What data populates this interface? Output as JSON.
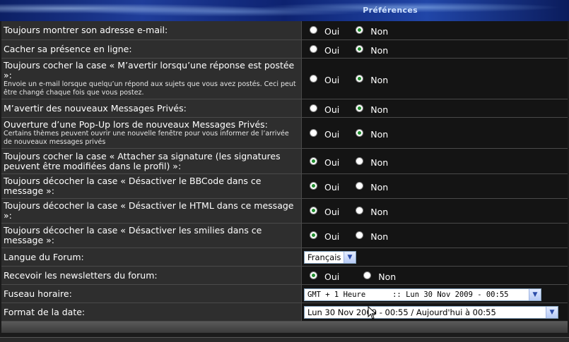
{
  "header": {
    "title": "Préférences"
  },
  "radio_labels": {
    "yes": "Oui",
    "no": "Non"
  },
  "rows": [
    {
      "label": "Toujours montrer son adresse e-mail:",
      "selected": "Non"
    },
    {
      "label": "Cacher sa présence en ligne:",
      "selected": "Non"
    },
    {
      "label": "Toujours cocher la case « M’avertir lorsqu’une réponse est postée »:",
      "note": "Envoie un e-mail lorsque quelqu’un répond aux sujets que vous avez postés. Ceci peut être changé chaque fois que vous postez.",
      "selected": "Non"
    },
    {
      "label": "M’avertir des nouveaux Messages Privés:",
      "selected": "Non"
    },
    {
      "label": "Ouverture d’une Pop-Up lors de nouveaux Messages Privés:",
      "note": "Certains thèmes peuvent ouvrir une nouvelle fenêtre pour vous informer de l’arrivée de nouveaux messages privés",
      "selected": "Non"
    },
    {
      "label": "Toujours cocher la case « Attacher sa signature (les signatures peuvent être modifiées dans le profil) »:",
      "selected": "Oui"
    },
    {
      "label": "Toujours décocher la case « Désactiver le BBCode dans ce message »:",
      "selected": "Oui"
    },
    {
      "label": "Toujours décocher la case « Désactiver le HTML dans ce message »:",
      "selected": "Oui"
    },
    {
      "label": "Toujours décocher la case « Désactiver les smilies dans ce message »:",
      "selected": "Oui"
    }
  ],
  "language": {
    "label": "Langue du Forum:",
    "value": "Français"
  },
  "newsletter": {
    "label": "Recevoir les newsletters du forum:",
    "selected": "Oui"
  },
  "timezone": {
    "label": "Fuseau horaire:",
    "value": "GMT + 1 Heure      :: Lun 30 Nov 2009 - 00:55"
  },
  "date_format": {
    "label": "Format de la date:",
    "value": "Lun 30 Nov 2009 - 00:55 / Aujourd'hui à 00:55"
  },
  "colors": {
    "checked_dot": "#1e8c2c",
    "label_bg": "#2e2e2e",
    "value_bg": "#141414",
    "header_blue": "#1f3d9a"
  }
}
